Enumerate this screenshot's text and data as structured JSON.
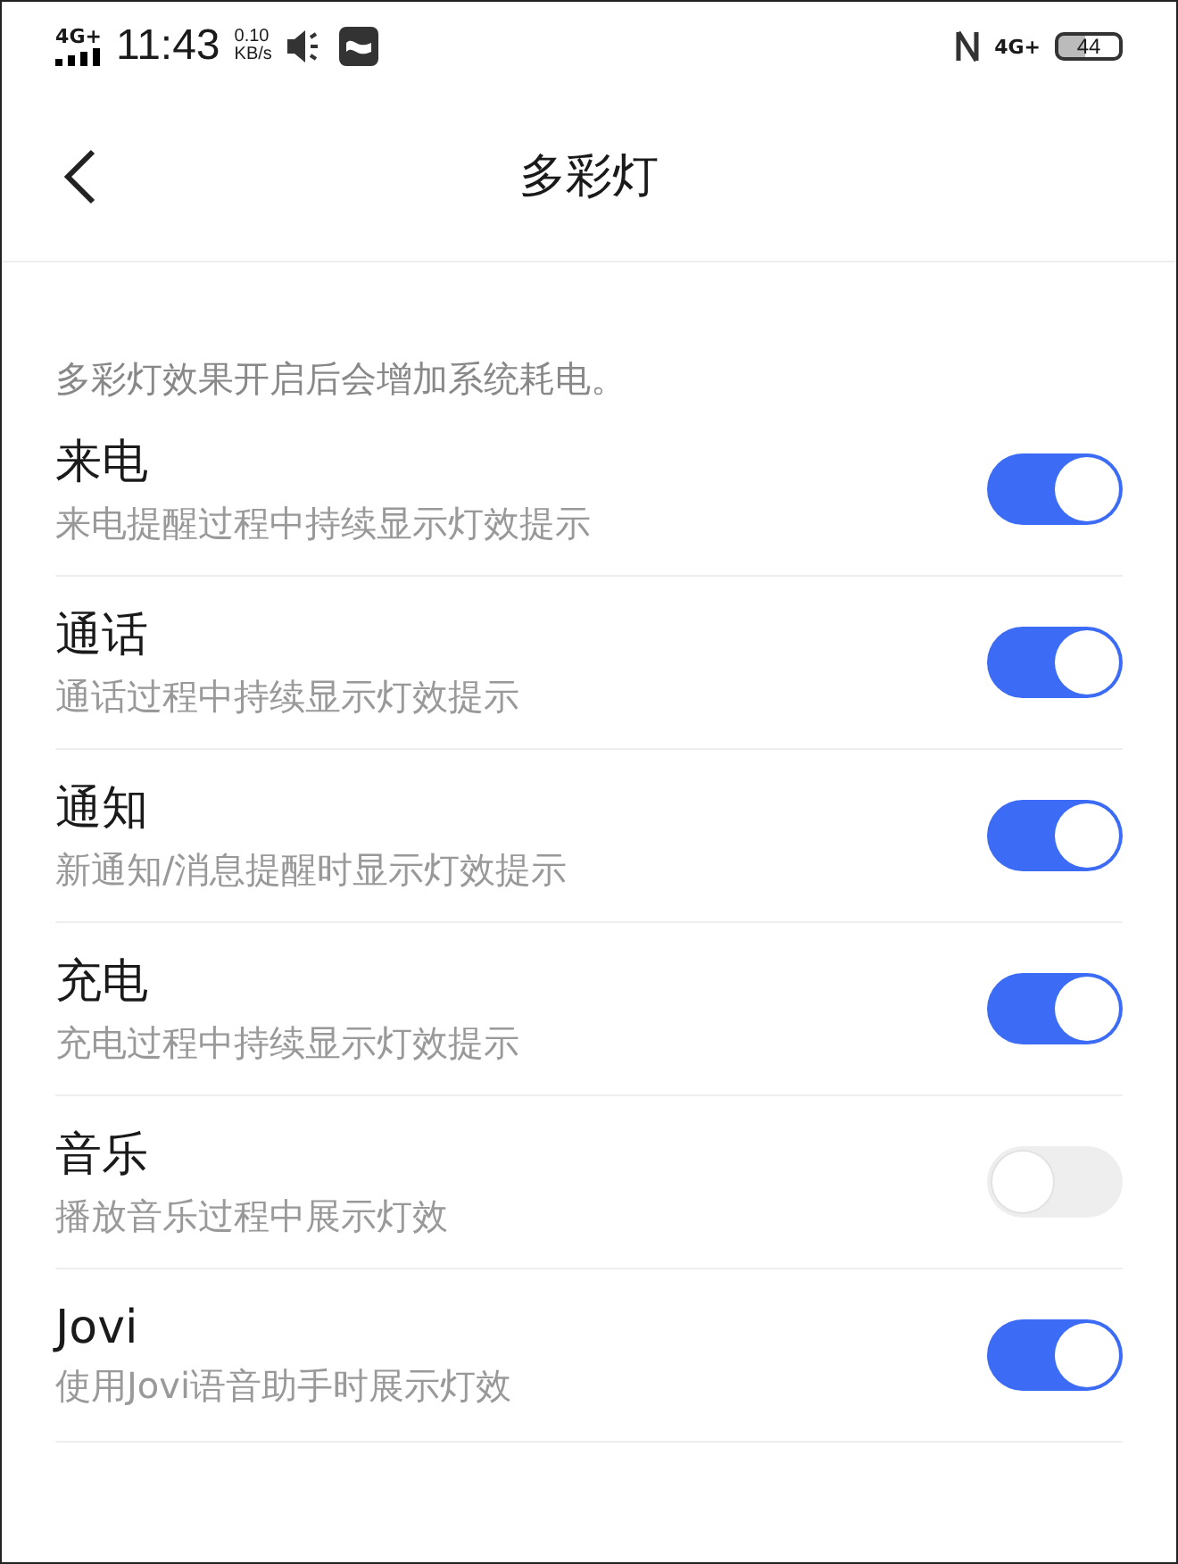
{
  "status_bar": {
    "network": "4G+",
    "time": "11:43",
    "speed_value": "0.10",
    "speed_unit": "KB/s",
    "network_right": "4G+",
    "battery": "44"
  },
  "header": {
    "title": "多彩灯"
  },
  "note": "多彩灯效果开启后会增加系统耗电。",
  "settings": [
    {
      "title": "来电",
      "subtitle": "来电提醒过程中持续显示灯效提示",
      "on": true
    },
    {
      "title": "通话",
      "subtitle": "通话过程中持续显示灯效提示",
      "on": true
    },
    {
      "title": "通知",
      "subtitle": "新通知/消息提醒时显示灯效提示",
      "on": true
    },
    {
      "title": "充电",
      "subtitle": "充电过程中持续显示灯效提示",
      "on": true
    },
    {
      "title": "音乐",
      "subtitle": "播放音乐过程中展示灯效",
      "on": false
    },
    {
      "title": "Jovi",
      "subtitle": "使用Jovi语音助手时展示灯效",
      "on": true
    }
  ]
}
